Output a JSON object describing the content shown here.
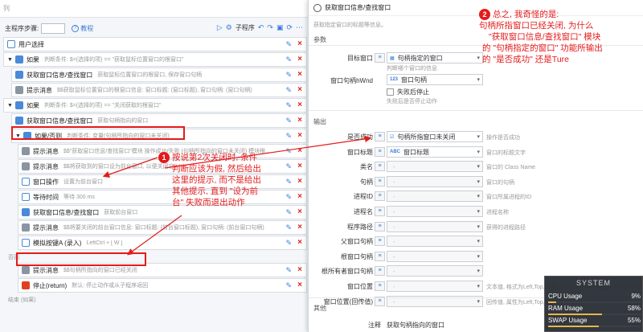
{
  "left": {
    "header_tab": "列",
    "toolbar": {
      "step_label": "主程序步骤:",
      "help_label": "教程",
      "subprogram_label": "子程序"
    },
    "rows": [
      {
        "name": "用户选择",
        "desc": ""
      },
      {
        "name": "如果",
        "desc": "判断条件: $=(选择的项) == \"获取鼠标位置窗口的根窗口\""
      },
      {
        "name": "获取窗口信息/查找窗口",
        "desc": "获取鼠标位置窗口的根窗口, 保存窗口句柄"
      },
      {
        "name": "提示消息",
        "desc": "$$获取鼠标位置窗口的根窗口信息: 窗口标题: (窗口标题), 窗口句柄: (窗口句柄)"
      },
      {
        "name": "如果",
        "desc": "判断条件: $=(选择的项) == \"关闭获取的根窗口\""
      },
      {
        "name": "获取窗口信息/查找窗口",
        "desc": "获取句柄指向的窗口"
      },
      {
        "name": "如果/否则",
        "desc": "判断条件: 变量(句柄所指向的窗口未关闭)"
      },
      {
        "name": "提示消息",
        "desc": "$$\"获取窗口信息/查找窗口\"模块 操作成功/失败 (句柄所指向的窗口未关闭) 模块根..."
      },
      {
        "name": "提示消息",
        "desc": "$$将获取到的窗口设为前台窗口, 以便关闭它"
      },
      {
        "name": "窗口操作",
        "desc": "设置为前台窗口"
      },
      {
        "name": "等待时间",
        "desc": "等待 300 ms"
      },
      {
        "name": "获取窗口信息/查找窗口",
        "desc": "获取前台窗口"
      },
      {
        "name": "提示消息",
        "desc": "$$将要关闭的前台窗口信息: 窗口标题: (前台窗口标题), 窗口句柄: (前台窗口句柄)"
      },
      {
        "name": "模拟按键A (录入)",
        "desc": "LeftCtrl + [ W ]"
      },
      {
        "name": "提示消息",
        "desc": "$$句柄所指向的窗口已经关闭"
      },
      {
        "name": "停止(return)",
        "desc": "默认: 停止动作或从子程序返回"
      }
    ],
    "else_label": "否则",
    "end_label": "结束 (如果)"
  },
  "dialog": {
    "title": "获取窗口信息/查找窗口",
    "subtitle": "获取指定窗口的标题等信息。",
    "params_label": "参数",
    "target_window_label": "目标窗口",
    "target_window_value": "句柄指定的窗口",
    "target_window_hint": "判断哪个窗口的信息",
    "handle_label": "窗口句柄hWnd",
    "handle_value": "窗口句柄",
    "fail_stop_label": "失败后停止",
    "fail_stop_hint": "失败后是否停止动作",
    "output_label": "输出",
    "outputs": [
      {
        "label": "是否成功",
        "value": "句柄所指窗口未关闭",
        "hint": "操作是否成功",
        "active": true
      },
      {
        "label": "窗口标题",
        "value": "窗口标题",
        "hint": "窗口的标题文字",
        "active": true
      },
      {
        "label": "类名",
        "value": "-",
        "hint": "窗口的 Class Name",
        "active": false
      },
      {
        "label": "句柄",
        "value": "-",
        "hint": "窗口的句柄",
        "active": false
      },
      {
        "label": "进程ID",
        "value": "-",
        "hint": "窗口所属进程的ID",
        "active": false
      },
      {
        "label": "进程名",
        "value": "-",
        "hint": "进程名称",
        "active": false
      },
      {
        "label": "程序路径",
        "value": "-",
        "hint": "获得的进程路径",
        "active": false
      },
      {
        "label": "父窗口句柄",
        "value": "-",
        "hint": "",
        "active": false
      },
      {
        "label": "根窗口句柄",
        "value": "-",
        "hint": "",
        "active": false
      },
      {
        "label": "根所有者窗口句柄",
        "value": "-",
        "hint": "",
        "active": false
      },
      {
        "label": "窗口位置",
        "value": "-",
        "hint": "文本值, 格式为Left,Top,Right,Bottom,Width,Height, 如:0,0,100,",
        "active": false
      },
      {
        "label": "窗口位置(回传值)",
        "value": "-",
        "hint": "回传值, 属性为Left,Top,Right,Bottom,Wi",
        "active": false
      }
    ],
    "other_label": "其他",
    "note_label": "注释",
    "note_value": "获取句柄指向的窗口"
  },
  "annotations": {
    "a1_number": "1",
    "a1_lines": [
      "按说第2次关闭时, 条件",
      "判断应该为假, 然后给出",
      "这里的提示, 而不是给出",
      "其他提示, 直到 \"设为前",
      "台\" 失败而退出动作"
    ],
    "a2_number": "2",
    "a2_lines": [
      "总之, 我奇怪的是:",
      "句柄所指窗口已经关闭, 为什么",
      "\"获取窗口信息/查找窗口\" 模块",
      "的 \"句柄指定的窗口\" 功能所输出",
      "的 \"是否成功\" 还是Ture"
    ]
  },
  "sysmon": {
    "title": "SYSTEM",
    "cpu_label": "CPU Usage",
    "cpu_value": "9%",
    "cpu_level": 0.09,
    "ram_label": "RAM Usage",
    "ram_value": "58%",
    "ram_level": 0.58,
    "swap_label": "SWAP Usage",
    "swap_value": "55%",
    "swap_level": 0.55
  },
  "colors": {
    "accent": "#3d7bd9",
    "annotation": "#e41b1b",
    "meter": "#e8b64a"
  }
}
